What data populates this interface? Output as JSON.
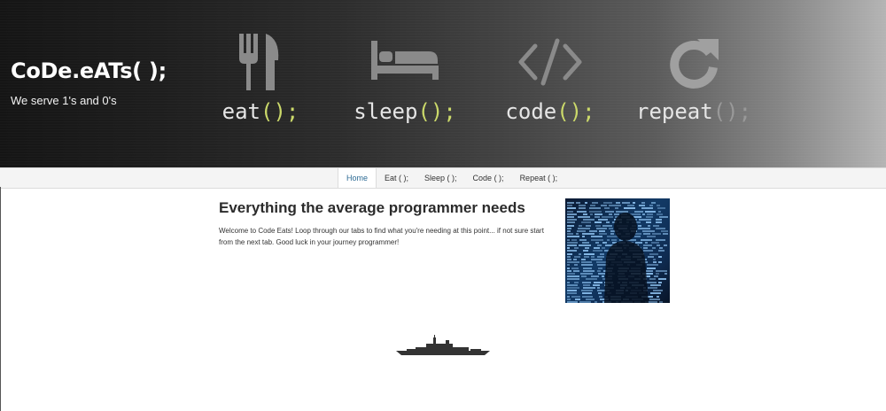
{
  "site": {
    "brand": "CoDe.eATs( );",
    "tagline": "We serve 1's and 0's"
  },
  "routine": [
    {
      "word": "eat",
      "paren": "();",
      "icon": "fork-knife-icon"
    },
    {
      "word": "sleep",
      "paren": "();",
      "icon": "bed-icon"
    },
    {
      "word": "code",
      "paren": "();",
      "icon": "code-brackets-icon"
    },
    {
      "word": "repeat",
      "paren": "();",
      "icon": "refresh-icon"
    }
  ],
  "nav": {
    "tabs": [
      {
        "label": "Home",
        "active": true
      },
      {
        "label": "Eat ( );"
      },
      {
        "label": "Sleep ( );"
      },
      {
        "label": "Code ( );"
      },
      {
        "label": "Repeat ( );"
      }
    ]
  },
  "main": {
    "headline": "Everything the average programmer needs",
    "intro": "Welcome to Code Eats! Loop through our tabs to find what you're needing at this point... if not sure start from the next tab. Good luck in your journey programmer!",
    "image": "programmer-code-photo"
  },
  "colors": {
    "accent_paren": "#cbd96a",
    "active_tab_text": "#2d6b95",
    "photo_blue": "#123a66"
  }
}
